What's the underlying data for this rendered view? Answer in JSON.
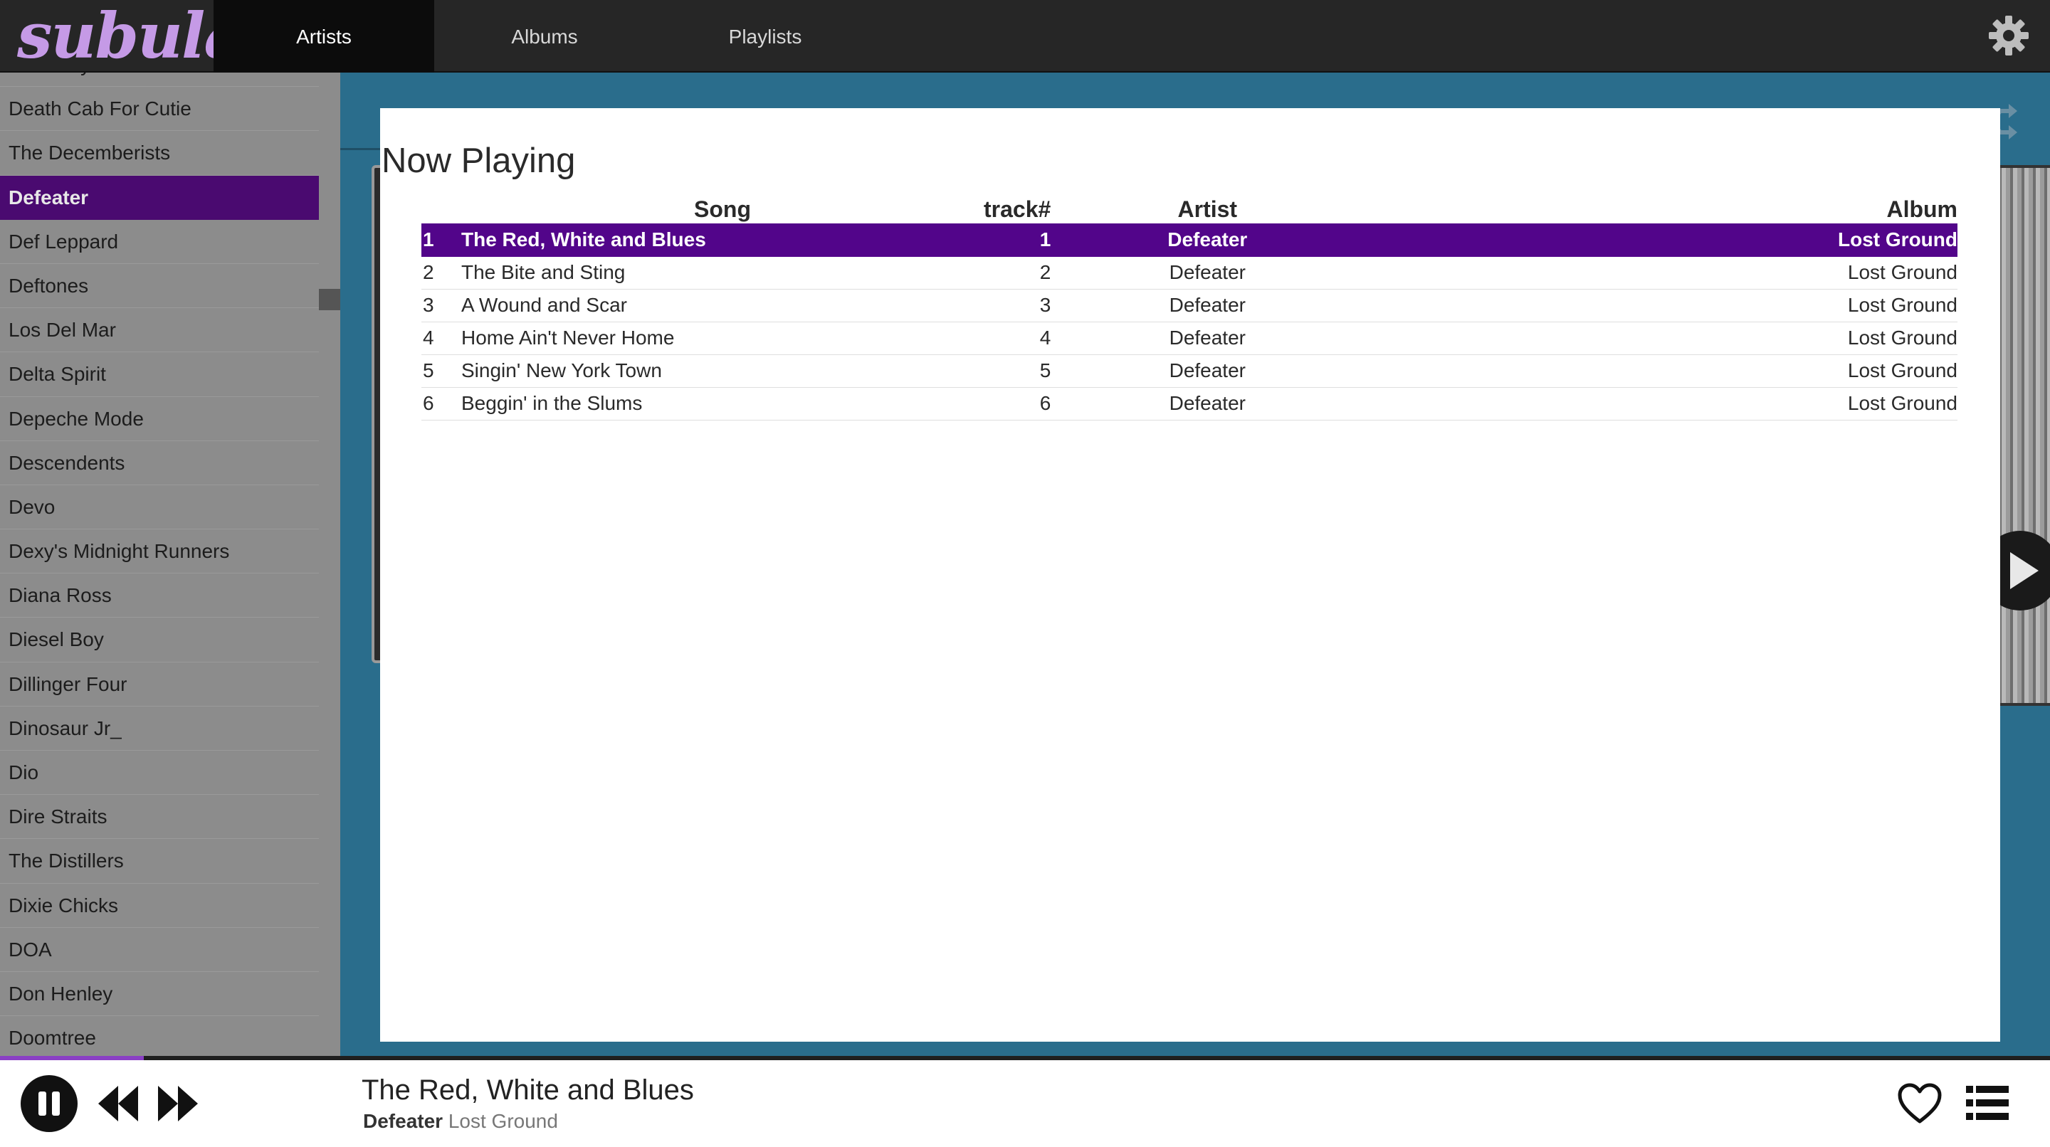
{
  "app": {
    "logo": "subular"
  },
  "nav": {
    "tabs": [
      {
        "label": "Artists",
        "active": true
      },
      {
        "label": "Albums",
        "active": false
      },
      {
        "label": "Playlists",
        "active": false
      }
    ],
    "settings_icon": "gear-icon"
  },
  "sidebar": {
    "artists": [
      "Death By Stereo",
      "Death Cab For Cutie",
      "The Decemberists",
      "Defeater",
      "Def Leppard",
      "Deftones",
      "Los Del Mar",
      "Delta Spirit",
      "Depeche Mode",
      "Descendents",
      "Devo",
      "Dexy's Midnight Runners",
      "Diana Ross",
      "Diesel Boy",
      "Dillinger Four",
      "Dinosaur Jr_",
      "Dio",
      "Dire Straits",
      "The Distillers",
      "Dixie Chicks",
      "DOA",
      "Don Henley",
      "Doomtree"
    ],
    "selected": "Defeater"
  },
  "now_playing_modal": {
    "title": "Now Playing",
    "columns": {
      "song": "Song",
      "track": "track#",
      "artist": "Artist",
      "album": "Album"
    },
    "rows": [
      {
        "index": "1",
        "song": "The Red, White and Blues",
        "track": "1",
        "artist": "Defeater",
        "album": "Lost Ground"
      },
      {
        "index": "2",
        "song": "The Bite and Sting",
        "track": "2",
        "artist": "Defeater",
        "album": "Lost Ground"
      },
      {
        "index": "3",
        "song": "A Wound and Scar",
        "track": "3",
        "artist": "Defeater",
        "album": "Lost Ground"
      },
      {
        "index": "4",
        "song": "Home Ain't Never Home",
        "track": "4",
        "artist": "Defeater",
        "album": "Lost Ground"
      },
      {
        "index": "5",
        "song": "Singin' New York Town",
        "track": "5",
        "artist": "Defeater",
        "album": "Lost Ground"
      },
      {
        "index": "6",
        "song": "Beggin' in the Slums",
        "track": "6",
        "artist": "Defeater",
        "album": "Lost Ground"
      }
    ],
    "current_index": 0
  },
  "player": {
    "title": "The Red, White and Blues",
    "artist": "Defeater",
    "album": "Lost Ground",
    "progress": 0.07,
    "state": "playing"
  },
  "colors": {
    "accent": "#52058a",
    "sidebar_selected": "#4a0a70",
    "background": "#2a6d8c",
    "logo": "#c59ae6"
  }
}
